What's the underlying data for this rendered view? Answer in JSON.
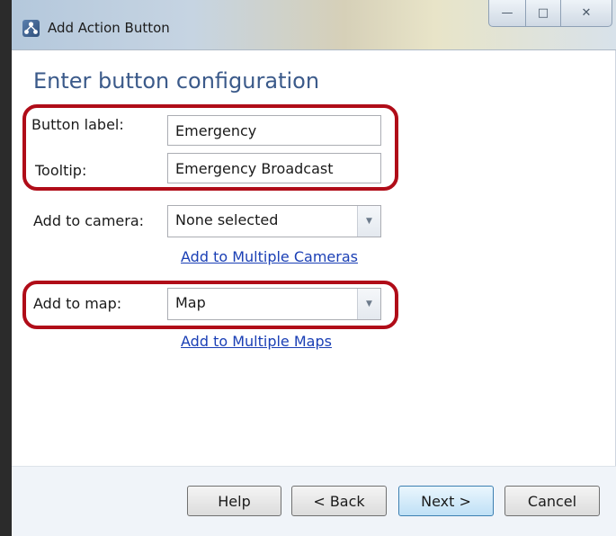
{
  "window": {
    "title": "Add Action Button",
    "controls": {
      "minimize": "—",
      "maximize": "□",
      "close": "✕"
    }
  },
  "heading": "Enter button configuration",
  "form": {
    "button_label": {
      "label": "Button label:",
      "value": "Emergency"
    },
    "tooltip": {
      "label": "Tooltip:",
      "value": "Emergency Broadcast"
    },
    "add_to_camera": {
      "label": "Add to camera:",
      "value": "None selected"
    },
    "multiple_cameras_link": "Add to Multiple Cameras",
    "add_to_map": {
      "label": "Add to map:",
      "value": "Map"
    },
    "multiple_maps_link": "Add to Multiple Maps"
  },
  "footer": {
    "help": "Help",
    "back": "< Back",
    "next": "Next >",
    "cancel": "Cancel"
  },
  "icons": {
    "app_icon": "network-icon",
    "dropdown_arrow": "chevron-down-icon"
  },
  "colors": {
    "heading": "#3b5a8a",
    "link": "#1a3fb5",
    "highlight": "#b00c18",
    "footer_bg": "#f0f4f9"
  }
}
